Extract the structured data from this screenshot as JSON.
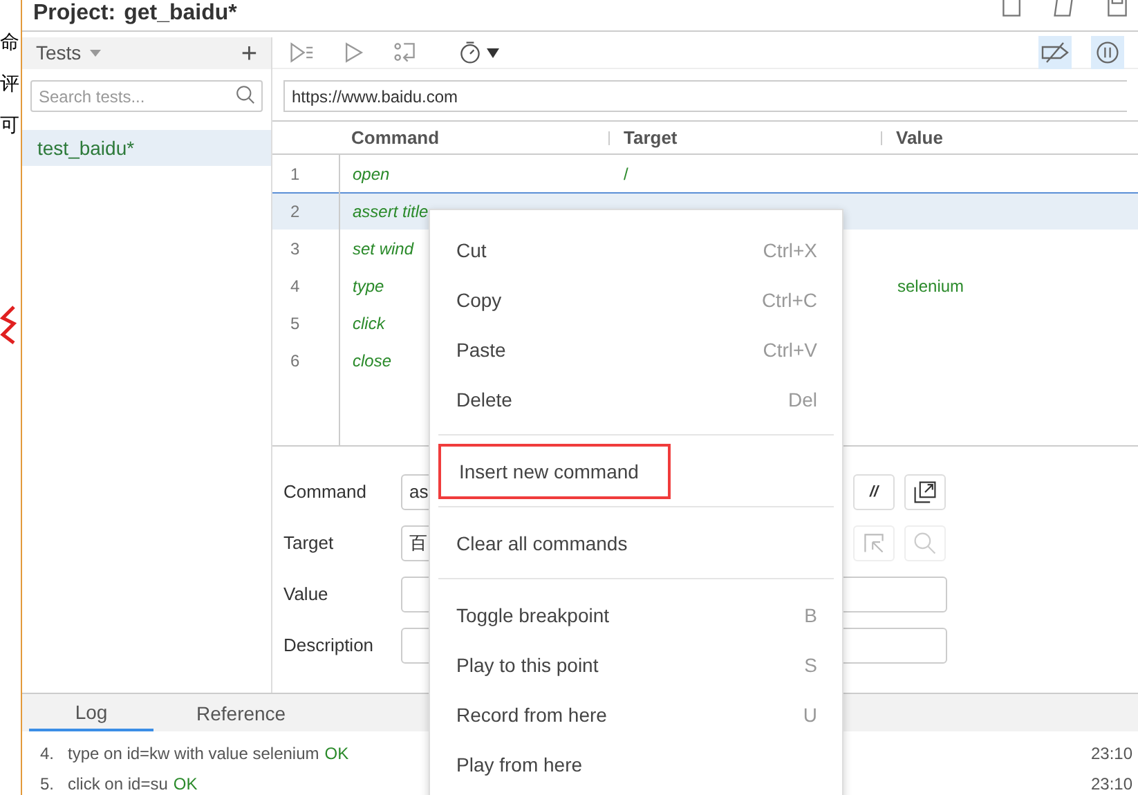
{
  "background_page": {
    "fragments": [
      "命",
      "评",
      "可"
    ]
  },
  "header": {
    "project_label": "Project:",
    "project_name": "get_baidu*"
  },
  "tests_panel": {
    "title": "Tests",
    "add": "+",
    "search": {
      "placeholder": "Search tests..."
    },
    "tests": [
      {
        "name": "test_baidu*",
        "selected": true
      }
    ]
  },
  "toolbar": {
    "toggles": [
      {
        "kind": "breakpoints",
        "active": true
      },
      {
        "kind": "pause",
        "active": true
      }
    ]
  },
  "url": "https://www.baidu.com",
  "table": {
    "columns": [
      "Command",
      "Target",
      "Value"
    ],
    "rows": [
      {
        "index": "1",
        "command": "open",
        "target": "/",
        "selected": false
      },
      {
        "index": "2",
        "command": "assert title",
        "selected": true
      },
      {
        "index": "3",
        "command": "set wind",
        "selected": false
      },
      {
        "index": "4",
        "command": "type",
        "value": "selenium",
        "selected": false
      },
      {
        "index": "5",
        "command": "click",
        "selected": false
      },
      {
        "index": "6",
        "command": "close",
        "selected": false
      }
    ]
  },
  "editor": {
    "fields": [
      {
        "label": "Command",
        "value": "as",
        "kind": "command"
      },
      {
        "label": "Target",
        "value": "百",
        "kind": "target"
      },
      {
        "label": "Value",
        "kind": "plain"
      },
      {
        "label": "Description",
        "kind": "plain"
      }
    ],
    "comment_button": "//"
  },
  "bottom_panel": {
    "tabs": [
      {
        "label": "Log",
        "selected": true
      },
      {
        "label": "Reference",
        "selected": false
      }
    ],
    "log": [
      {
        "number": "4.",
        "text": "type on id=kw with value selenium",
        "status": "OK",
        "time": "23:10"
      },
      {
        "number": "5.",
        "text": "click on id=su",
        "status": "OK",
        "time": "23:10"
      }
    ]
  },
  "context_menu": {
    "groups": [
      [
        {
          "label": "Cut",
          "shortcut": "Ctrl+X",
          "highlighted": false
        },
        {
          "label": "Copy",
          "shortcut": "Ctrl+C",
          "highlighted": false
        },
        {
          "label": "Paste",
          "shortcut": "Ctrl+V",
          "highlighted": false
        },
        {
          "label": "Delete",
          "shortcut": "Del",
          "highlighted": false
        }
      ],
      [
        {
          "label": "Insert new command",
          "highlighted": true
        }
      ],
      [
        {
          "label": "Clear all commands",
          "highlighted": false
        }
      ],
      [
        {
          "label": "Toggle breakpoint",
          "shortcut": "B",
          "highlighted": false
        },
        {
          "label": "Play to this point",
          "shortcut": "S",
          "highlighted": false
        },
        {
          "label": "Record from here",
          "shortcut": "U",
          "highlighted": false
        },
        {
          "label": "Play from here",
          "highlighted": false
        }
      ]
    ]
  }
}
